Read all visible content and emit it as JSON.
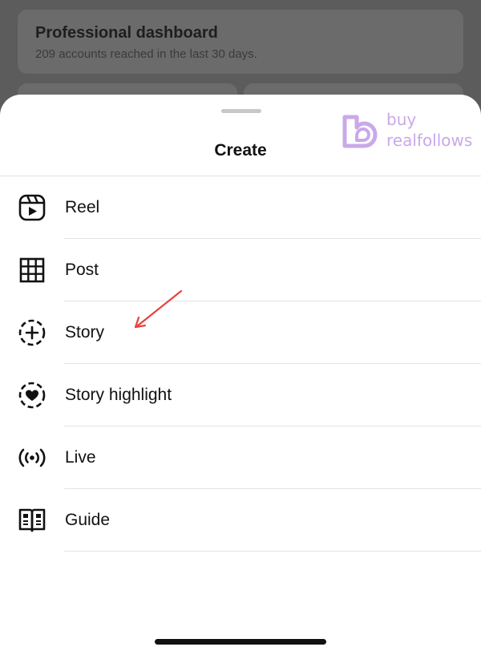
{
  "background": {
    "dashboard_title": "Professional dashboard",
    "dashboard_subtitle": "209 accounts reached in the last 30 days."
  },
  "sheet": {
    "title": "Create",
    "items": [
      {
        "label": "Reel",
        "icon": "reel-icon"
      },
      {
        "label": "Post",
        "icon": "grid-icon"
      },
      {
        "label": "Story",
        "icon": "story-add-icon"
      },
      {
        "label": "Story highlight",
        "icon": "story-highlight-icon"
      },
      {
        "label": "Live",
        "icon": "live-icon"
      },
      {
        "label": "Guide",
        "icon": "guide-icon"
      }
    ]
  },
  "watermark": {
    "line1": "buy",
    "line2": "realfollows",
    "color": "#c9a9e8"
  },
  "annotation": {
    "arrow_color": "#e8413c",
    "icon": "red-arrow-icon"
  }
}
